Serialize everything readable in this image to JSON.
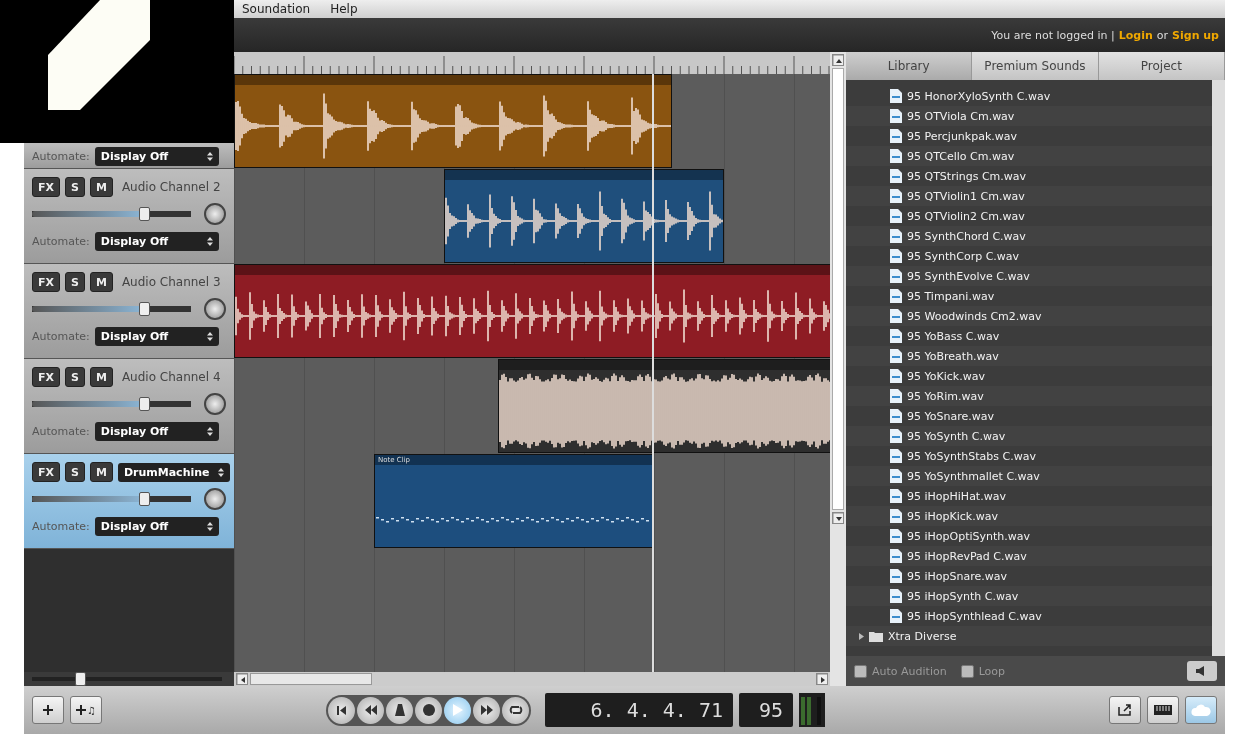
{
  "menu": [
    {
      "label": "Soundation"
    },
    {
      "label": "Help"
    }
  ],
  "account": {
    "status": "You are not logged in |",
    "login": "Login",
    "separator": "or",
    "signup": "Sign up"
  },
  "channels": [
    {
      "kind": "hidden",
      "automate_label": "Automate:",
      "automate": "Display Off",
      "selected": false
    },
    {
      "kind": "audio",
      "fx": "FX",
      "solo": "S",
      "mute": "M",
      "name": "Audio Channel 2",
      "level": 0.7,
      "automate_label": "Automate:",
      "automate": "Display Off",
      "selected": false
    },
    {
      "kind": "audio",
      "fx": "FX",
      "solo": "S",
      "mute": "M",
      "name": "Audio Channel 3",
      "level": 0.7,
      "automate_label": "Automate:",
      "automate": "Display Off",
      "selected": false
    },
    {
      "kind": "audio",
      "fx": "FX",
      "solo": "S",
      "mute": "M",
      "name": "Audio Channel 4",
      "level": 0.7,
      "automate_label": "Automate:",
      "automate": "Display Off",
      "selected": false
    },
    {
      "kind": "instrument",
      "fx": "FX",
      "solo": "S",
      "mute": "M",
      "name": "DrumMachine",
      "level": 0.7,
      "automate_label": "Automate:",
      "automate": "Display Off",
      "selected": true
    }
  ],
  "clips": [
    {
      "kind": "audio",
      "color": "#8a5410"
    },
    {
      "kind": "audio",
      "color": "#1f4f7c"
    },
    {
      "kind": "audio",
      "color": "#8e1c24"
    },
    {
      "kind": "audio",
      "color": "#2e2e2e"
    },
    {
      "kind": "note",
      "color": "#1d4e7e",
      "label": "Note Clip"
    }
  ],
  "library": {
    "tabs": [
      {
        "label": "Library",
        "selected": true
      },
      {
        "label": "Premium Sounds",
        "selected": false
      },
      {
        "label": "Project",
        "selected": false
      }
    ],
    "items": [
      {
        "kind": "file",
        "label": "95 HonorXyloSynth C.wav"
      },
      {
        "kind": "file",
        "label": "95 OTViola Cm.wav"
      },
      {
        "kind": "file",
        "label": "95 Percjunkpak.wav"
      },
      {
        "kind": "file",
        "label": "95 QTCello Cm.wav"
      },
      {
        "kind": "file",
        "label": "95 QTStrings Cm.wav"
      },
      {
        "kind": "file",
        "label": "95 QTViolin1 Cm.wav"
      },
      {
        "kind": "file",
        "label": "95 QTViolin2 Cm.wav"
      },
      {
        "kind": "file",
        "label": "95 SynthChord C.wav"
      },
      {
        "kind": "file",
        "label": "95 SynthCorp C.wav"
      },
      {
        "kind": "file",
        "label": "95 SynthEvolve C.wav"
      },
      {
        "kind": "file",
        "label": "95 Timpani.wav"
      },
      {
        "kind": "file",
        "label": "95 Woodwinds Cm2.wav"
      },
      {
        "kind": "file",
        "label": "95 YoBass C.wav"
      },
      {
        "kind": "file",
        "label": "95 YoBreath.wav"
      },
      {
        "kind": "file",
        "label": "95 YoKick.wav"
      },
      {
        "kind": "file",
        "label": "95 YoRim.wav"
      },
      {
        "kind": "file",
        "label": "95 YoSnare.wav"
      },
      {
        "kind": "file",
        "label": "95 YoSynth C.wav"
      },
      {
        "kind": "file",
        "label": "95 YoSynthStabs C.wav"
      },
      {
        "kind": "file",
        "label": "95 YoSynthmallet C.wav"
      },
      {
        "kind": "file",
        "label": "95 iHopHiHat.wav"
      },
      {
        "kind": "file",
        "label": "95 iHopKick.wav"
      },
      {
        "kind": "file",
        "label": "95 iHopOptiSynth.wav"
      },
      {
        "kind": "file",
        "label": "95 iHopRevPad C.wav"
      },
      {
        "kind": "file",
        "label": "95 iHopSnare.wav"
      },
      {
        "kind": "file",
        "label": "95 iHopSynth C.wav"
      },
      {
        "kind": "file",
        "label": "95 iHopSynthlead C.wav"
      },
      {
        "kind": "folder",
        "label": "Xtra Diverse",
        "expanded": false
      }
    ],
    "options": [
      {
        "label": "Auto Audition",
        "checked": false
      },
      {
        "label": "Loop",
        "checked": false
      }
    ]
  },
  "toolbar": {
    "add_left": [
      {
        "kind": "add"
      },
      {
        "kind": "add-instrument",
        "label": "♫"
      }
    ],
    "transport": [
      {
        "kind": "start"
      },
      {
        "kind": "rewind"
      },
      {
        "kind": "metronome"
      },
      {
        "kind": "record"
      },
      {
        "kind": "play"
      },
      {
        "kind": "forward"
      },
      {
        "kind": "loop"
      }
    ],
    "position": "6. 4. 4. 71",
    "tempo": "95"
  },
  "zoom": {
    "level": 0.25
  }
}
